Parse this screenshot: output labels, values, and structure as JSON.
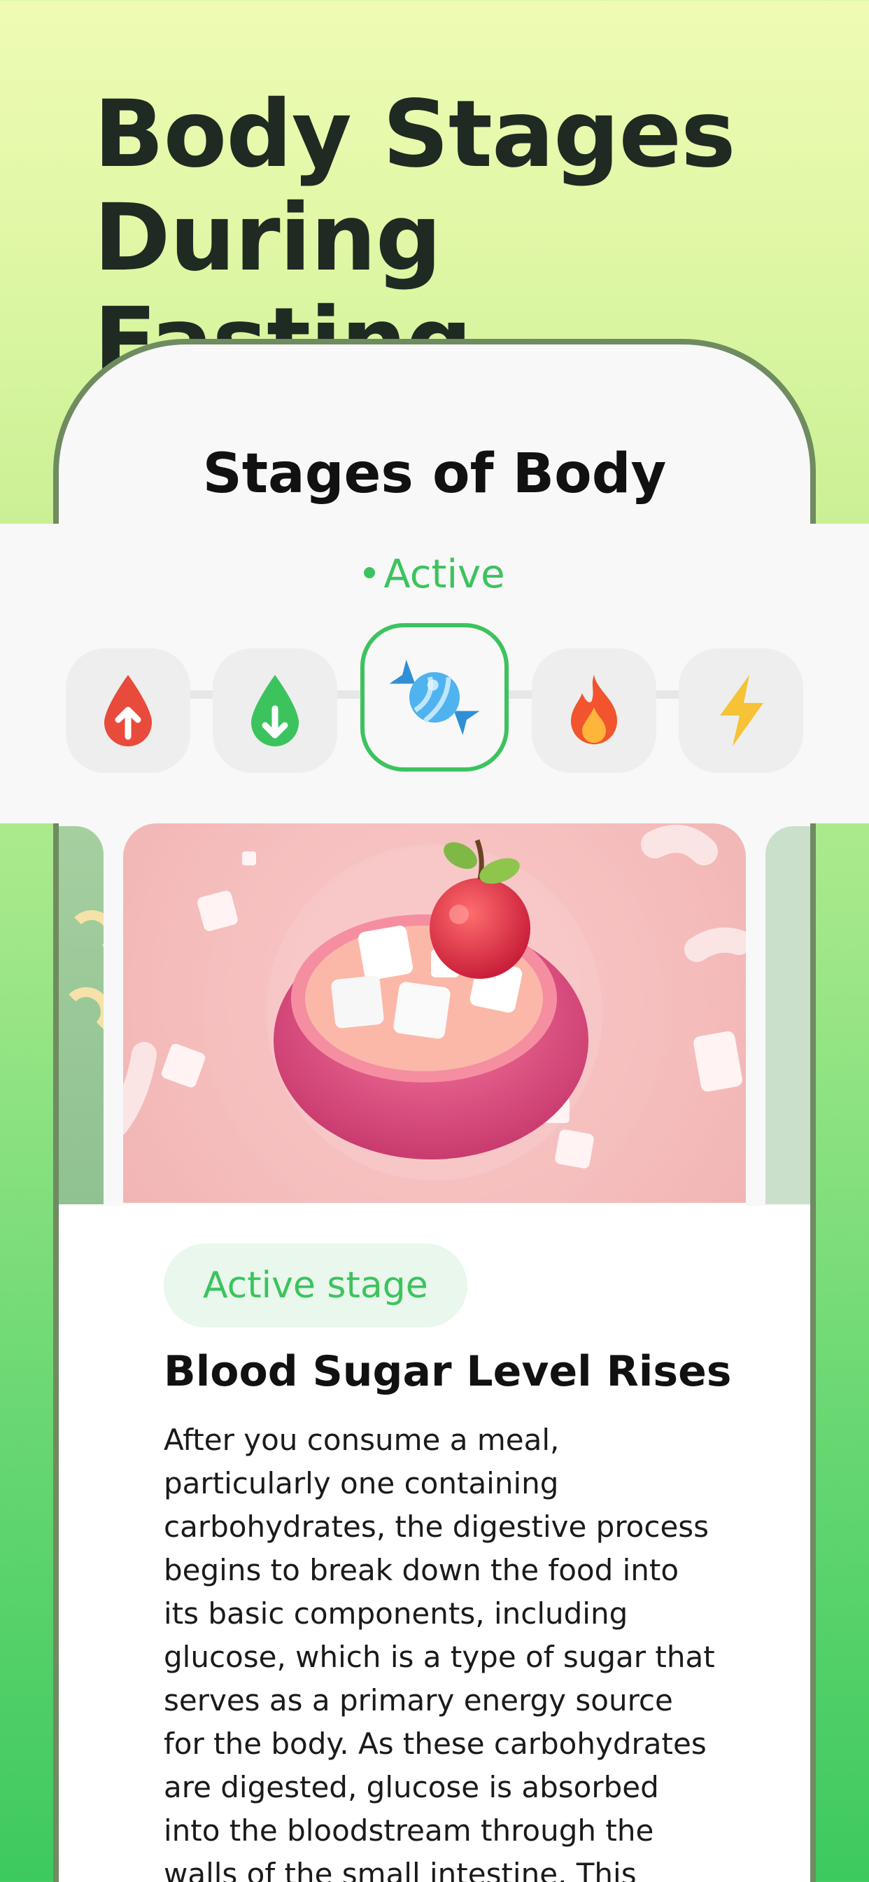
{
  "headline": {
    "line1": "Body Stages",
    "line2": "During Fasting"
  },
  "screen": {
    "title": "Stages of Body",
    "active_label": "Active"
  },
  "stages": [
    {
      "icon": "blood-drop-up-icon",
      "color": "#e84a3c"
    },
    {
      "icon": "drop-down-icon",
      "color": "#3cc35e"
    },
    {
      "icon": "candy-icon",
      "color": "#3aa7e8",
      "active": true
    },
    {
      "icon": "fire-icon",
      "color": "#f2542d"
    },
    {
      "icon": "lightning-icon",
      "color": "#f6c236"
    }
  ],
  "card": {
    "badge": "Active stage",
    "title": "Blood Sugar Level Rises",
    "body": "After you consume a meal, particularly one containing carbohydrates, the digestive process begins to break down the food into its basic components, including glucose, which is a type of sugar that serves as a primary energy source for the body. As these carbohydrates are digested, glucose is absorbed into the bloodstream through the walls of the small intestine. This causes a rise in"
  },
  "colors": {
    "accent": "#3cc35e",
    "frame": "#6f8b60",
    "headline": "#1f2a22"
  }
}
